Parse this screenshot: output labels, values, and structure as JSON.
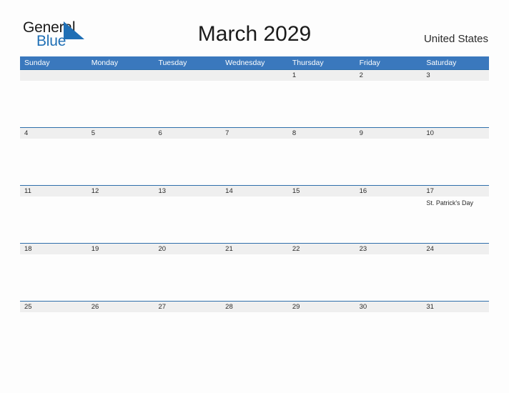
{
  "brand": {
    "name_part1": "General",
    "name_part2": "Blue",
    "triangle_icon": "triangle-icon",
    "color_dark": "#1a1a1a",
    "color_blue": "#1f6fb5"
  },
  "header": {
    "title": "March 2029",
    "region": "United States"
  },
  "colors": {
    "header_blue": "#3a78bd",
    "rule_blue": "#2f6fab",
    "date_band_gray": "#efefef",
    "page_bg": "#fdfdfd",
    "text": "#2a2a2a"
  },
  "calendar": {
    "month": "March",
    "year": "2029",
    "day_headers": [
      "Sunday",
      "Monday",
      "Tuesday",
      "Wednesday",
      "Thursday",
      "Friday",
      "Saturday"
    ],
    "weeks": [
      {
        "days": [
          {
            "date": "",
            "events": []
          },
          {
            "date": "",
            "events": []
          },
          {
            "date": "",
            "events": []
          },
          {
            "date": "",
            "events": []
          },
          {
            "date": "1",
            "events": []
          },
          {
            "date": "2",
            "events": []
          },
          {
            "date": "3",
            "events": []
          }
        ]
      },
      {
        "days": [
          {
            "date": "4",
            "events": []
          },
          {
            "date": "5",
            "events": []
          },
          {
            "date": "6",
            "events": []
          },
          {
            "date": "7",
            "events": []
          },
          {
            "date": "8",
            "events": []
          },
          {
            "date": "9",
            "events": []
          },
          {
            "date": "10",
            "events": []
          }
        ]
      },
      {
        "days": [
          {
            "date": "11",
            "events": []
          },
          {
            "date": "12",
            "events": []
          },
          {
            "date": "13",
            "events": []
          },
          {
            "date": "14",
            "events": []
          },
          {
            "date": "15",
            "events": []
          },
          {
            "date": "16",
            "events": []
          },
          {
            "date": "17",
            "events": [
              "St. Patrick's Day"
            ]
          }
        ]
      },
      {
        "days": [
          {
            "date": "18",
            "events": []
          },
          {
            "date": "19",
            "events": []
          },
          {
            "date": "20",
            "events": []
          },
          {
            "date": "21",
            "events": []
          },
          {
            "date": "22",
            "events": []
          },
          {
            "date": "23",
            "events": []
          },
          {
            "date": "24",
            "events": []
          }
        ]
      },
      {
        "days": [
          {
            "date": "25",
            "events": []
          },
          {
            "date": "26",
            "events": []
          },
          {
            "date": "27",
            "events": []
          },
          {
            "date": "28",
            "events": []
          },
          {
            "date": "29",
            "events": []
          },
          {
            "date": "30",
            "events": []
          },
          {
            "date": "31",
            "events": []
          }
        ]
      }
    ]
  }
}
